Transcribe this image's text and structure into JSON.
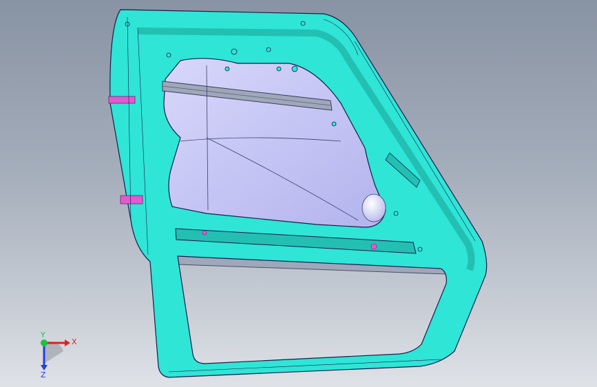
{
  "viewport": {
    "background_top": "#8893a3",
    "background_bottom": "#dfe2e7"
  },
  "model": {
    "name": "door-inner-panel",
    "colors": {
      "panel": "#2ee5d6",
      "panel_shade": "#23bfb3",
      "edge": "#1a1a4a",
      "window_glass": "#bcbcf2",
      "window_glass_light": "#d7d7fb",
      "hinge_tab": "#e05ad0",
      "rail": "#9fa7ba"
    },
    "icons": [
      "hinge-tab",
      "mount-hole",
      "speaker-dome",
      "latch-rail"
    ]
  },
  "triad": {
    "x_label": "X",
    "y_label": "Y",
    "z_label": "Z",
    "x_color": "#e02020",
    "y_color": "#20c040",
    "z_color": "#2040e0"
  }
}
